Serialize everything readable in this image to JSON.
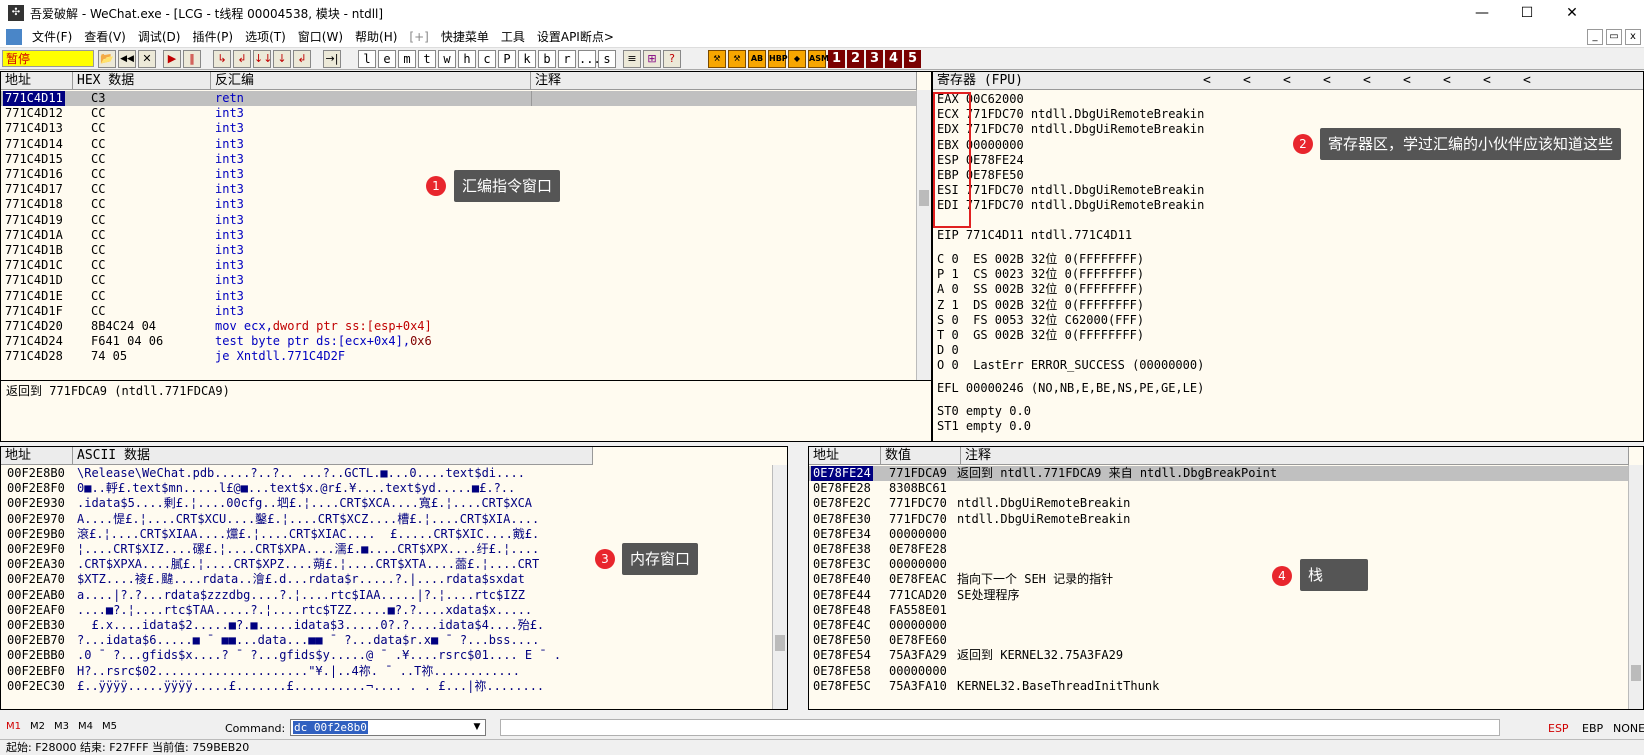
{
  "window": {
    "icon": "bug-icon",
    "title": "吾爱破解 - WeChat.exe - [LCG - t线程  00004538, 模块 - ntdll]",
    "controls": [
      "—",
      "☐",
      "✕"
    ]
  },
  "menu": {
    "items": [
      "文件(F)",
      "查看(V)",
      "调试(D)",
      "插件(P)",
      "选项(T)",
      "窗口(W)",
      "帮助(H)",
      "[+]",
      "快捷菜单",
      "工具",
      "设置API断点>"
    ],
    "mdi_controls": [
      "_",
      "▭",
      "x"
    ]
  },
  "toolbar": {
    "status": "暂停",
    "buttons": [
      "📂",
      "◀◀",
      "✕",
      "▶",
      "‖",
      "↳",
      "↲",
      "↓↓",
      "↓",
      "↲",
      "→|"
    ],
    "letters": [
      "l",
      "e",
      "m",
      "t",
      "w",
      "h",
      "c",
      "P",
      "k",
      "b",
      "r",
      "...",
      "s"
    ],
    "tools": [
      "≡",
      "⊞",
      "?"
    ],
    "orange": [
      "⚒",
      "⚒",
      "AB",
      "HBP",
      "◆",
      "ASM"
    ],
    "numbers": [
      "1",
      "2",
      "3",
      "4",
      "5"
    ]
  },
  "cpu": {
    "headers": [
      "地址",
      "HEX 数据",
      "反汇编",
      "注释"
    ],
    "rows": [
      {
        "addr": "771C4D11",
        "hex": "C3",
        "asm": "retn",
        "selected": true
      },
      {
        "addr": "771C4D12",
        "hex": "CC",
        "asm": "int3"
      },
      {
        "addr": "771C4D13",
        "hex": "CC",
        "asm": "int3"
      },
      {
        "addr": "771C4D14",
        "hex": "CC",
        "asm": "int3"
      },
      {
        "addr": "771C4D15",
        "hex": "CC",
        "asm": "int3"
      },
      {
        "addr": "771C4D16",
        "hex": "CC",
        "asm": "int3"
      },
      {
        "addr": "771C4D17",
        "hex": "CC",
        "asm": "int3"
      },
      {
        "addr": "771C4D18",
        "hex": "CC",
        "asm": "int3"
      },
      {
        "addr": "771C4D19",
        "hex": "CC",
        "asm": "int3"
      },
      {
        "addr": "771C4D1A",
        "hex": "CC",
        "asm": "int3"
      },
      {
        "addr": "771C4D1B",
        "hex": "CC",
        "asm": "int3"
      },
      {
        "addr": "771C4D1C",
        "hex": "CC",
        "asm": "int3"
      },
      {
        "addr": "771C4D1D",
        "hex": "CC",
        "asm": "int3"
      },
      {
        "addr": "771C4D1E",
        "hex": "CC",
        "asm": "int3"
      },
      {
        "addr": "771C4D1F",
        "hex": "CC",
        "asm": "int3"
      },
      {
        "addr": "771C4D20",
        "hex": "8B4C24 04",
        "asm": "mov ecx,",
        "asm2": "dword ptr ss:[esp+0x4]"
      },
      {
        "addr": "771C4D24",
        "hex": "F641 04 06",
        "asm": "test byte ptr ds:[ecx+0x4],",
        "asm2": "0x6"
      },
      {
        "addr": "771C4D28",
        "hex": "74 05",
        "asm": "je Xntdll.771C4D2F"
      }
    ],
    "info": "返回到 771FDCA9 (ntdll.771FDCA9)"
  },
  "registers": {
    "header": "寄存器 (FPU)",
    "arrows": [
      "<",
      "<",
      "<",
      "<",
      "<",
      "<",
      "<",
      "<",
      "<"
    ],
    "gp": [
      {
        "name": "EAX",
        "value": "00C62000",
        "comment": ""
      },
      {
        "name": "ECX",
        "value": "771FDC70",
        "comment": "ntdll.DbgUiRemoteBreakin"
      },
      {
        "name": "EDX",
        "value": "771FDC70",
        "comment": "ntdll.DbgUiRemoteBreakin"
      },
      {
        "name": "EBX",
        "value": "00000000",
        "comment": ""
      },
      {
        "name": "ESP",
        "value": "0E78FE24",
        "comment": ""
      },
      {
        "name": "EBP",
        "value": "0E78FE50",
        "comment": ""
      },
      {
        "name": "ESI",
        "value": "771FDC70",
        "comment": "ntdll.DbgUiRemoteBreakin"
      },
      {
        "name": "EDI",
        "value": "771FDC70",
        "comment": "ntdll.DbgUiRemoteBreakin"
      }
    ],
    "eip": "EIP 771C4D11 ntdll.771C4D11",
    "flags": [
      "C 0  ES 002B 32位 0(FFFFFFFF)",
      "P 1  CS 0023 32位 0(FFFFFFFF)",
      "A 0  SS 002B 32位 0(FFFFFFFF)",
      "Z 1  DS 002B 32位 0(FFFFFFFF)",
      "S 0  FS 0053 32位 C62000(FFF)",
      "T 0  GS 002B 32位 0(FFFFFFFF)",
      "D 0",
      "O 0  LastErr ERROR_SUCCESS (00000000)"
    ],
    "efl": "EFL 00000246 (NO,NB,E,BE,NS,PE,GE,LE)",
    "fpu": [
      "ST0 empty 0.0",
      "ST1 empty 0.0"
    ]
  },
  "dump": {
    "headers": [
      "地址",
      "ASCII 数据"
    ],
    "rows": [
      {
        "addr": "00F2E8B0",
        "ascii": "\\Release\\WeChat.pdb.....?..?.. ...?..GCTL.■...0....text$di...."
      },
      {
        "addr": "00F2E8F0",
        "ascii": "0■..軤£.text$mn.....l£@■...text$x.@r£.¥....text$yd.....■£.?.."
      },
      {
        "addr": "00F2E930",
        "ascii": ".idata$5....剰£.¦....00cfg..垇£.¦....CRT$XCA....寬£.¦....CRT$XCA"
      },
      {
        "addr": "00F2E970",
        "ascii": "A....惿£.¦....CRT$XCU....鑿£.¦....CRT$XCZ....槽£.¦....CRT$XIA...."
      },
      {
        "addr": "00F2E9B0",
        "ascii": "滾£.¦....CRT$XIAA....爣£.¦....CRT$XIAC....  £.....CRT$XIC....戭£."
      },
      {
        "addr": "00F2E9F0",
        "ascii": "¦....CRT$XIZ....磥£.¦....CRT$XPA....濡£.■....CRT$XPX....纡£.¦...."
      },
      {
        "addr": "00F2EA30",
        "ascii": ".CRT$XPXA....膩£.¦....CRT$XPZ....蒴£.¦....CRT$XTA....蘦£.¦....CRT"
      },
      {
        "addr": "00F2EA70",
        "ascii": "$XTZ....祾£.颹....rdata..澮£.d...rdata$r.....?.|....rdata$sxdat"
      },
      {
        "addr": "00F2EAB0",
        "ascii": "a....|?.?...rdata$zzzdbg....?.¦....rtc$IAA.....|?.¦....rtc$IZZ"
      },
      {
        "addr": "00F2EAF0",
        "ascii": "....■?.¦....rtc$TAA.....?.¦....rtc$TZZ.....■?.?....xdata$x....."
      },
      {
        "addr": "00F2EB30",
        "ascii": "  £.x....idata$2.....■?.■.....idata$3.....0?.?....idata$4....殆£."
      },
      {
        "addr": "00F2EB70",
        "ascii": "?...idata$6.....■ ¯ ■■...data...■■ ¯ ?...data$r.x■ ¯ ?...bss...."
      },
      {
        "addr": "00F2EBB0",
        "ascii": ".0 ¯ ?...gfids$x....? ¯ ?...gfids$y.....@ ¯ .¥....rsrc$01.... E ¯ ."
      },
      {
        "addr": "00F2EBF0",
        "ascii": "H?..rsrc$02.....................\"¥.|..4祢. ¯ ..T祢............"
      },
      {
        "addr": "00F2EC30",
        "ascii": "£..ÿÿÿÿ.....ÿÿÿÿ.....£.......£..........¬.... . . £...|祢........"
      }
    ]
  },
  "stack": {
    "headers": [
      "地址",
      "数值",
      "注释"
    ],
    "rows": [
      {
        "addr": "0E78FE24",
        "val": "771FDCA9",
        "cmt": "返回到 ntdll.771FDCA9 来自 ntdll.DbgBreakPoint",
        "selected": true
      },
      {
        "addr": "0E78FE28",
        "val": "8308BC61",
        "cmt": ""
      },
      {
        "addr": "0E78FE2C",
        "val": "771FDC70",
        "cmt": "ntdll.DbgUiRemoteBreakin"
      },
      {
        "addr": "0E78FE30",
        "val": "771FDC70",
        "cmt": "ntdll.DbgUiRemoteBreakin"
      },
      {
        "addr": "0E78FE34",
        "val": "00000000",
        "cmt": ""
      },
      {
        "addr": "0E78FE38",
        "val": "0E78FE28",
        "cmt": ""
      },
      {
        "addr": "0E78FE3C",
        "val": "00000000",
        "cmt": ""
      },
      {
        "addr": "0E78FE40",
        "val": "0E78FEAC",
        "cmt": "指向下一个 SEH 记录的指针"
      },
      {
        "addr": "0E78FE44",
        "val": "771CAD20",
        "cmt": "SE处理程序"
      },
      {
        "addr": "0E78FE48",
        "val": "FA558E01",
        "cmt": ""
      },
      {
        "addr": "0E78FE4C",
        "val": "00000000",
        "cmt": ""
      },
      {
        "addr": "0E78FE50",
        "val": "0E78FE60",
        "cmt": ""
      },
      {
        "addr": "0E78FE54",
        "val": "75A3FA29",
        "cmt": "返回到 KERNEL32.75A3FA29"
      },
      {
        "addr": "0E78FE58",
        "val": "00000000",
        "cmt": ""
      },
      {
        "addr": "0E78FE5C",
        "val": "75A3FA10",
        "cmt": "KERNEL32.BaseThreadInitThunk"
      }
    ]
  },
  "annotations": [
    {
      "num": "1",
      "text": "汇编指令窗口"
    },
    {
      "num": "2",
      "text": "寄存器区，学过汇编的小伙伴应该知道这些"
    },
    {
      "num": "3",
      "text": "内存窗口"
    },
    {
      "num": "4",
      "text": "栈"
    }
  ],
  "commandbar": {
    "markers": [
      "M1",
      "M2",
      "M3",
      "M4",
      "M5"
    ],
    "label": "Command:",
    "value": "dc 00f2e8b0",
    "regs": [
      "ESP",
      "EBP",
      "NONE"
    ]
  },
  "statusbar": {
    "text": "起始: F28000 结束: F27FFF 当前值: 759BEB20"
  },
  "colors": {
    "pane_bg": "#fffbf0",
    "selection": "#000080",
    "asm_blue": "#0000c0",
    "asm_red": "#d00000",
    "note_bg": "#555555",
    "badge": "#e8262d",
    "pause_bg": "#ffff00"
  }
}
